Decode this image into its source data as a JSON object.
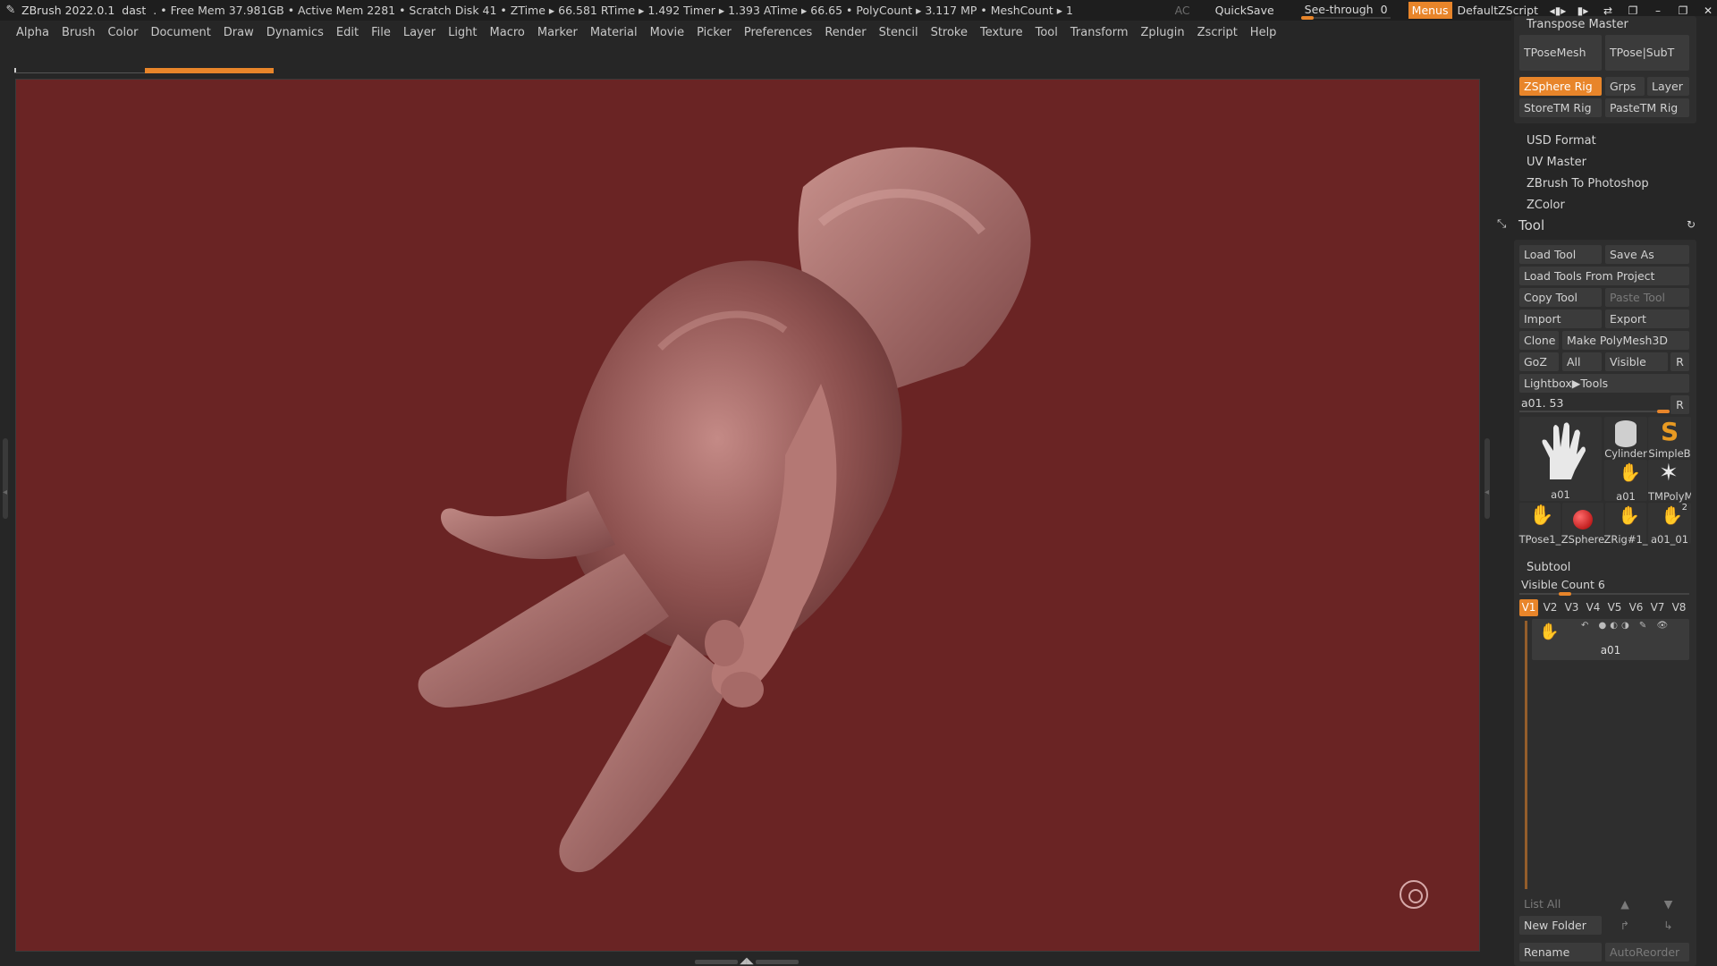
{
  "titlebar": {
    "app": "ZBrush 2022.0.1",
    "doc": "dast",
    "stats": ". • Free Mem 37.981GB • Active Mem 2281 • Scratch Disk 41 •  ZTime ▸ 66.581 RTime ▸ 1.492 Timer ▸ 1.393 ATime ▸ 66.65 • PolyCount ▸ 3.117 MP  • MeshCount ▸ 1",
    "ac": "AC",
    "quicksave": "QuickSave",
    "seethrough_label": "See-through",
    "seethrough_value": "0",
    "menus": "Menus",
    "default_zscript": "DefaultZScript"
  },
  "menubar": [
    "Alpha",
    "Brush",
    "Color",
    "Document",
    "Draw",
    "Dynamics",
    "Edit",
    "File",
    "Layer",
    "Light",
    "Macro",
    "Marker",
    "Material",
    "Movie",
    "Picker",
    "Preferences",
    "Render",
    "Stencil",
    "Stroke",
    "Texture",
    "Tool",
    "Transform",
    "Zplugin",
    "Zscript",
    "Help"
  ],
  "colors": {
    "accent": "#e8852a",
    "canvas_bg": "#6a2424",
    "panel_bg": "#262626",
    "button_bg": "#3b3b3b"
  },
  "zplugin": {
    "transpose_master": "Transpose Master",
    "tposemesh": "TPoseMesh",
    "tpose_subt": "TPose|SubT",
    "zsphere_rig": "ZSphere Rig",
    "grps": "Grps",
    "layer": "Layer",
    "storetm_rig": "StoreTM Rig",
    "pastetm_rig": "PasteTM Rig",
    "usd_format": "USD Format",
    "uv_master": "UV Master",
    "zbrush_to_photoshop": "ZBrush To Photoshop",
    "zcolor": "ZColor"
  },
  "tool": {
    "title": "Tool",
    "load_tool": "Load Tool",
    "save_as": "Save As",
    "load_from_project": "Load Tools From Project",
    "copy_tool": "Copy Tool",
    "paste_tool": "Paste Tool",
    "import": "Import",
    "export": "Export",
    "clone": "Clone",
    "make_polymesh": "Make PolyMesh3D",
    "goz": "GoZ",
    "all": "All",
    "visible": "Visible",
    "r": "R",
    "lightbox_tools": "Lightbox▶Tools",
    "current_tool": "a01. 53",
    "slider_r": "R",
    "thumbs": {
      "main": "a01",
      "cylinder": "Cylinder",
      "simpleb": "SimpleB",
      "a01_small": "a01",
      "tmpoly": "TMPolyM",
      "tpose1": "TPose1_",
      "zsphere": "ZSphere",
      "zrig": "ZRig#1_",
      "a01_01": "a01_01",
      "a01_01_count": "2"
    }
  },
  "subtool": {
    "title": "Subtool",
    "visible_count_label": "Visible Count",
    "visible_count": "6",
    "visible_count_fraction": 0.25,
    "versions": [
      "V1",
      "V2",
      "V3",
      "V4",
      "V5",
      "V6",
      "V7",
      "V8"
    ],
    "active_version": "V1",
    "item_name": "a01",
    "list_all": "List All",
    "new_folder": "New Folder",
    "rename": "Rename",
    "autoreorder": "AutoReorder"
  }
}
